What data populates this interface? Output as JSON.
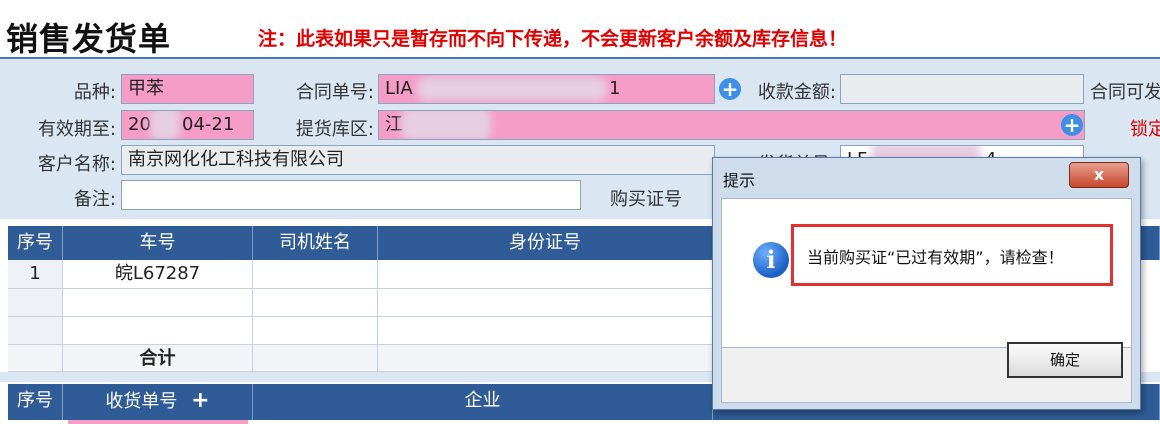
{
  "header": {
    "title": "销售发货单",
    "warning": "注：此表如果只是暂存而不向下传递，不会更新客户余额及库存信息！"
  },
  "form": {
    "variety_label": "品种:",
    "variety_value": "甲苯",
    "contract_label": "合同单号:",
    "contract_prefix": "LIA",
    "contract_suffix": "1",
    "payment_label": "收款金额:",
    "payment_value": "",
    "contract_avail_label": "合同可发",
    "valid_label": "有效期至:",
    "valid_prefix": "20",
    "valid_suffix": "04-21",
    "warehouse_label": "提货库区:",
    "warehouse_value": "江",
    "lock_text": "锁定",
    "customer_label": "客户名称:",
    "customer_value": "南京网化化工科技有限公司",
    "shipment_label": "发货单号:",
    "shipment_prefix": "LF",
    "shipment_suffix": "4",
    "remark_label": "备注:",
    "remark_value": "",
    "purchase_cert_label": "购买证号"
  },
  "vehicle_table": {
    "headers": [
      "序号",
      "车号",
      "司机姓名",
      "身份证号"
    ],
    "rows": [
      [
        "1",
        "皖L67287",
        "",
        ""
      ],
      [
        "",
        "",
        "",
        ""
      ],
      [
        "",
        "",
        "",
        ""
      ]
    ],
    "total_label": "合计"
  },
  "receipt_table": {
    "headers": [
      "序号",
      "收货单号",
      "企业"
    ]
  },
  "dialog": {
    "title": "提示",
    "close_label": "x",
    "message": "当前购买证“已过有效期”，请检查！",
    "ok_label": "确定"
  },
  "colors": {
    "header_blue": "#2f5c97",
    "required_pink": "#f59dc6",
    "warning_red": "#e00000",
    "form_bg": "#dbe6f3"
  }
}
